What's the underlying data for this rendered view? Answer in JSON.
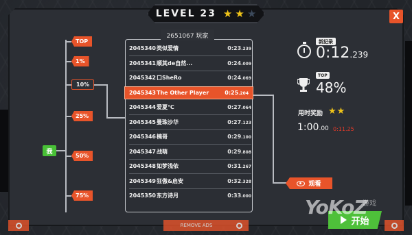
{
  "header": {
    "level_label": "LEVEL 23",
    "stars_earned": 2,
    "stars_total": 3
  },
  "close_label": "X",
  "percentile_tags": [
    "TOP",
    "1%",
    "10%",
    "25%",
    "50%",
    "75%"
  ],
  "me_label": "我",
  "leaderboard": {
    "title": "2651067 玩家",
    "rows": [
      {
        "id": "2045340",
        "name": "类似爱情",
        "time": "0:23",
        "ms": ".239"
      },
      {
        "id": "2045341",
        "name": "顺其de自然...",
        "time": "0:24",
        "ms": ".009"
      },
      {
        "id": "2045342",
        "name": "口SheRo",
        "time": "0:24",
        "ms": ".069"
      },
      {
        "id": "2045343",
        "name": "The Other Player",
        "time": "0:25",
        "ms": ".204"
      },
      {
        "id": "2045344",
        "name": "爱夏℃",
        "time": "0:27",
        "ms": ".064"
      },
      {
        "id": "2045345",
        "name": "曼珠沙华",
        "time": "0:27",
        "ms": ".123"
      },
      {
        "id": "2045346",
        "name": "楠哥",
        "time": "0:29",
        "ms": ".100"
      },
      {
        "id": "2045347",
        "name": "战萌",
        "time": "0:29",
        "ms": ".808"
      },
      {
        "id": "2045348",
        "name": "如梦浅依",
        "time": "0:31",
        "ms": ".267"
      },
      {
        "id": "2045349",
        "name": "狂傲&启安",
        "time": "0:32",
        "ms": ".328"
      },
      {
        "id": "2045350",
        "name": "东方诗月",
        "time": "0:33",
        "ms": ".000"
      }
    ],
    "highlight_index": 3
  },
  "stats": {
    "record_badge": "新纪录",
    "record_time": "0:12",
    "record_ms": ".239",
    "top_badge": "TOP",
    "percentile": "48%",
    "reward_label": "用时奖励",
    "reward_stars": "★★",
    "reward_time": "1:00",
    "reward_ms": ".00",
    "reward_red": "0:11.25"
  },
  "watch_label": "观看",
  "bottom": {
    "remove_ads": "REMOVE ADS",
    "start_label": "开始"
  },
  "watermark": {
    "logo": "YoKoZ",
    "site": "游戏"
  },
  "colors": {
    "accent": "#e8542a",
    "go": "#4ec03a",
    "star": "#f0c419"
  }
}
